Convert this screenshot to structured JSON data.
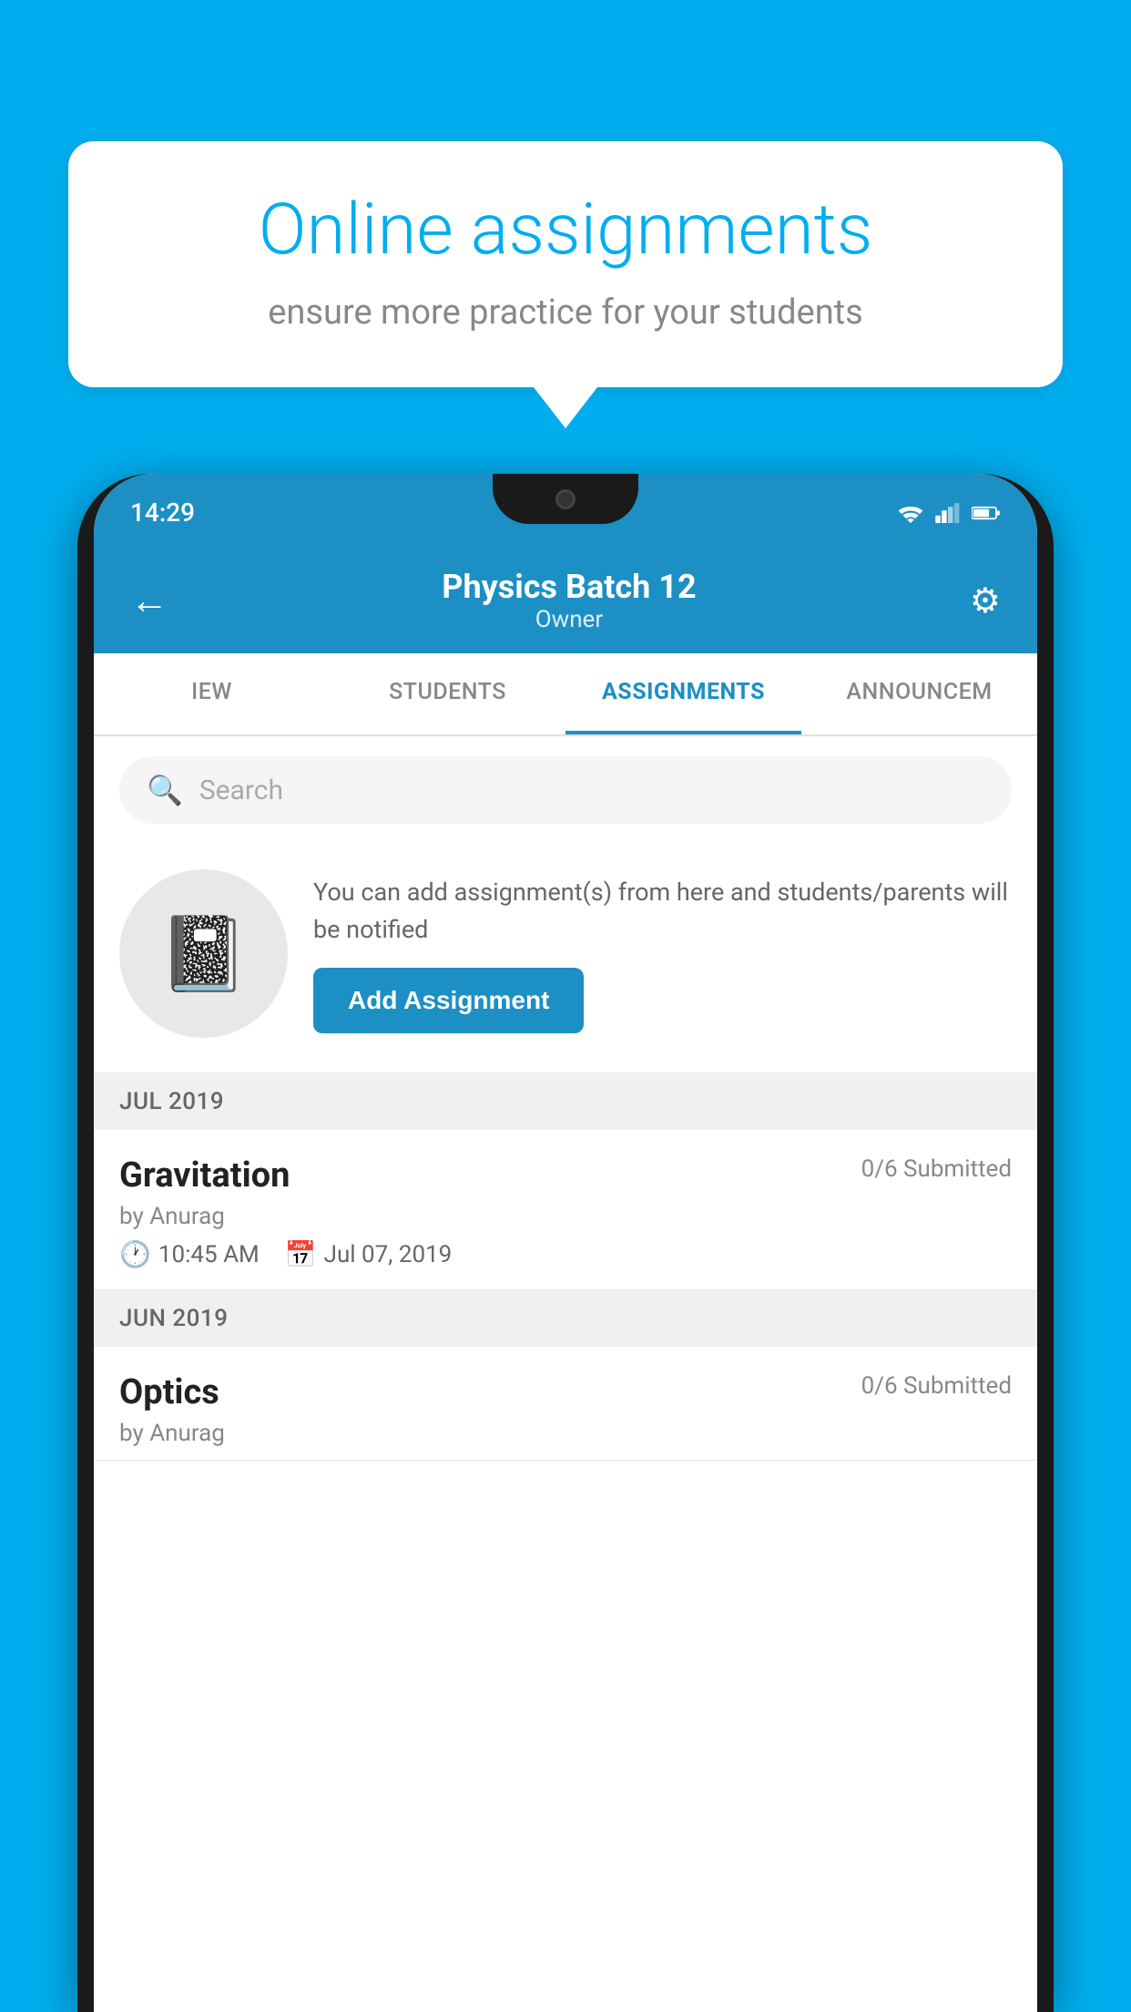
{
  "background": {
    "color": "#00AEEF"
  },
  "speech_bubble": {
    "title": "Online assignments",
    "subtitle": "ensure more practice for your students"
  },
  "status_bar": {
    "time": "14:29"
  },
  "header": {
    "title": "Physics Batch 12",
    "subtitle": "Owner",
    "back_label": "←",
    "settings_label": "⚙"
  },
  "tabs": [
    {
      "label": "IEW",
      "active": false
    },
    {
      "label": "STUDENTS",
      "active": false
    },
    {
      "label": "ASSIGNMENTS",
      "active": true
    },
    {
      "label": "ANNOUNCEM",
      "active": false
    }
  ],
  "search": {
    "placeholder": "Search"
  },
  "promo": {
    "text": "You can add assignment(s) from here and students/parents will be notified",
    "button_label": "Add Assignment"
  },
  "sections": [
    {
      "label": "JUL 2019",
      "assignments": [
        {
          "name": "Gravitation",
          "submitted": "0/6 Submitted",
          "by": "by Anurag",
          "time": "10:45 AM",
          "date": "Jul 07, 2019"
        }
      ]
    },
    {
      "label": "JUN 2019",
      "assignments": [
        {
          "name": "Optics",
          "submitted": "0/6 Submitted",
          "by": "by Anurag",
          "time": "",
          "date": ""
        }
      ]
    }
  ]
}
